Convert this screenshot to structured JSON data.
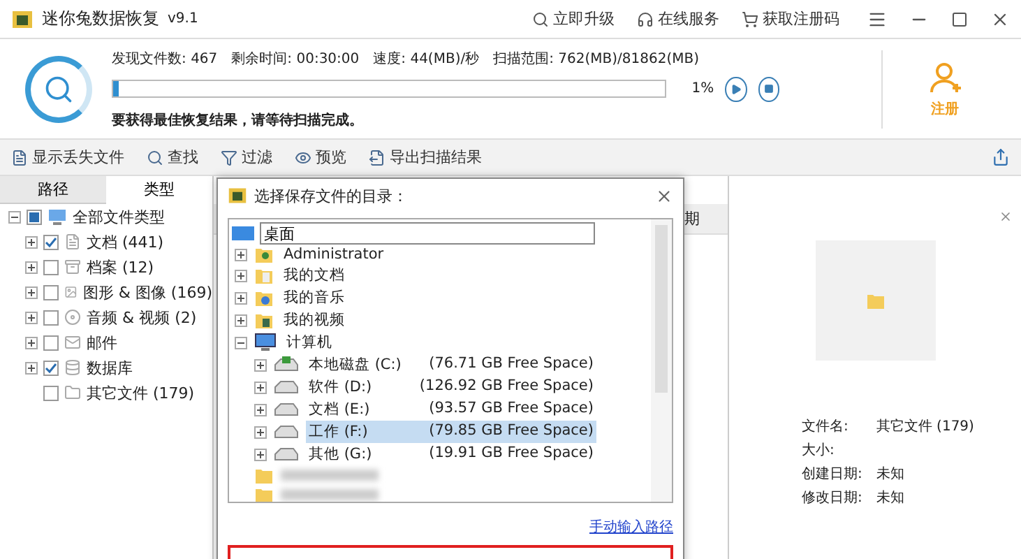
{
  "title_bar": {
    "app_title": "迷你兔数据恢复",
    "version": "v9.1",
    "links": [
      {
        "kind": "upgrade",
        "label": "立即升级"
      },
      {
        "kind": "service",
        "label": "在线服务"
      },
      {
        "kind": "cart",
        "label": "获取注册码"
      }
    ]
  },
  "scan": {
    "stats": [
      {
        "label": "发现文件数:",
        "value": "467"
      },
      {
        "label": "剩余时间:",
        "value": "00:30:00"
      },
      {
        "label": "速度:",
        "value": "44(MB)/秒"
      },
      {
        "label": "扫描范围:",
        "value": "762(MB)/81862(MB)"
      }
    ],
    "level": 0.01,
    "percent": "1%",
    "message": "要获得最佳恢复结果，请等待扫描完成。",
    "register": "注册"
  },
  "toolbar": [
    {
      "kind": "document",
      "label": "显示丢失文件"
    },
    {
      "kind": "search",
      "label": "查找"
    },
    {
      "kind": "filter",
      "label": "过滤"
    },
    {
      "kind": "eye",
      "label": "预览"
    },
    {
      "kind": "export",
      "label": "导出扫描结果"
    }
  ],
  "left_tabs": [
    {
      "label": "路径",
      "selected": false
    },
    {
      "label": "类型",
      "selected": true
    }
  ],
  "type_tree": {
    "label": "全部文件类型",
    "partial": true,
    "children": [
      {
        "kind": "document",
        "label": "文档 (441)",
        "checked": true,
        "expandable": true
      },
      {
        "kind": "archive",
        "label": "档案 (12)",
        "checked": false,
        "expandable": true
      },
      {
        "kind": "image",
        "label": "图形 & 图像 (169)",
        "checked": false,
        "expandable": true
      },
      {
        "kind": "media",
        "label": "音频 & 视频 (2)",
        "checked": false,
        "expandable": true
      },
      {
        "kind": "mail",
        "label": "邮件",
        "checked": false,
        "expandable": true
      },
      {
        "kind": "database",
        "label": "数据库",
        "checked": true,
        "expandable": true
      },
      {
        "kind": "folder",
        "label": "其它文件 (179)",
        "checked": false,
        "expandable": false
      }
    ]
  },
  "column_header": "期",
  "dialog": {
    "title": "选择保存文件的目录：",
    "location": "桌面",
    "tree": [
      {
        "kind": "user",
        "label": "Administrator",
        "expanded": false,
        "selected": false
      },
      {
        "kind": "docs",
        "label": "我的文档",
        "expanded": false,
        "selected": false
      },
      {
        "kind": "music",
        "label": "我的音乐",
        "expanded": false,
        "selected": false
      },
      {
        "kind": "video",
        "label": "我的视频",
        "expanded": false,
        "selected": false
      },
      {
        "kind": "computer",
        "label": "计算机",
        "expanded": true,
        "selected": false,
        "children": [
          {
            "kind": "system-drive",
            "label": "本地磁盘 (C:)",
            "free": "(76.71 GB Free Space)",
            "selected": false
          },
          {
            "kind": "drive",
            "label": "软件 (D:)",
            "free": "(126.92 GB Free Space)",
            "selected": false
          },
          {
            "kind": "drive",
            "label": "文档 (E:)",
            "free": "(93.57 GB Free Space)",
            "selected": false
          },
          {
            "kind": "drive",
            "label": "工作 (F:)",
            "free": "(79.85 GB Free Space)",
            "selected": true
          },
          {
            "kind": "drive",
            "label": "其他 (G:)",
            "free": "(19.91 GB Free Space)",
            "selected": false
          }
        ]
      },
      {
        "kind": "blurred"
      },
      {
        "kind": "blurred"
      }
    ],
    "link": "手动输入路径"
  },
  "preview": {
    "fields": [
      {
        "label": "文件名:",
        "value": "其它文件 (179)"
      },
      {
        "label": "大小:"
      },
      {
        "label": "创建日期:",
        "value": "未知"
      },
      {
        "label": "修改日期:",
        "value": "未知"
      }
    ]
  }
}
